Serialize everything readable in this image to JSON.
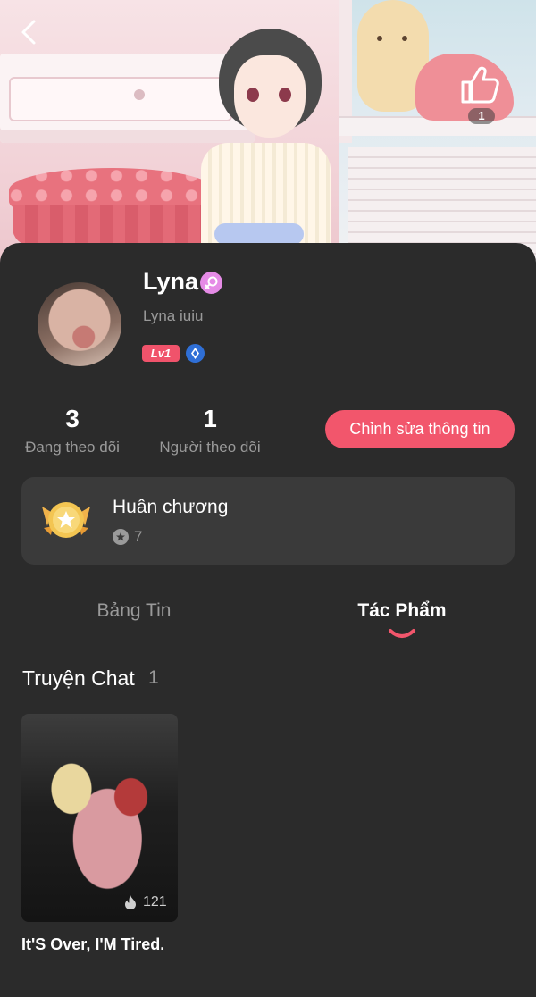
{
  "header": {
    "like_count": "1"
  },
  "profile": {
    "name": "Lyna",
    "username": "Lyna iuiu",
    "level": "Lv1"
  },
  "stats": {
    "following_count": "3",
    "following_label": "Đang theo dõi",
    "followers_count": "1",
    "followers_label": "Người theo dõi"
  },
  "edit_button": "Chỉnh sửa thông tin",
  "medal": {
    "title": "Huân chương",
    "count": "7"
  },
  "tabs": [
    {
      "label": "Bảng Tin",
      "active": false
    },
    {
      "label": "Tác Phẩm",
      "active": true
    }
  ],
  "section": {
    "title": "Truyện Chat",
    "count": "1"
  },
  "works": [
    {
      "title": "It'S Over, I'M Tired.",
      "views": "121"
    }
  ],
  "colors": {
    "accent": "#f2566c",
    "panel": "#2b2b2b",
    "card": "#3a3a3a",
    "muted": "#9a9a9a"
  }
}
